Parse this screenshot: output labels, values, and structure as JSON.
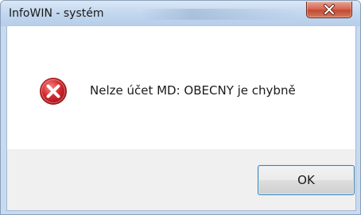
{
  "window": {
    "title": "InfoWIN - systém"
  },
  "dialog": {
    "icon": "error-icon",
    "message": "Nelze účet MD: OBECNY je chybně",
    "ok_label": "OK"
  },
  "colors": {
    "titlebar": "#c4d8ef",
    "close_button": "#c24a33",
    "error_red": "#c8202a",
    "footer": "#f0f0f0",
    "ok_border": "#3c7fb1"
  }
}
